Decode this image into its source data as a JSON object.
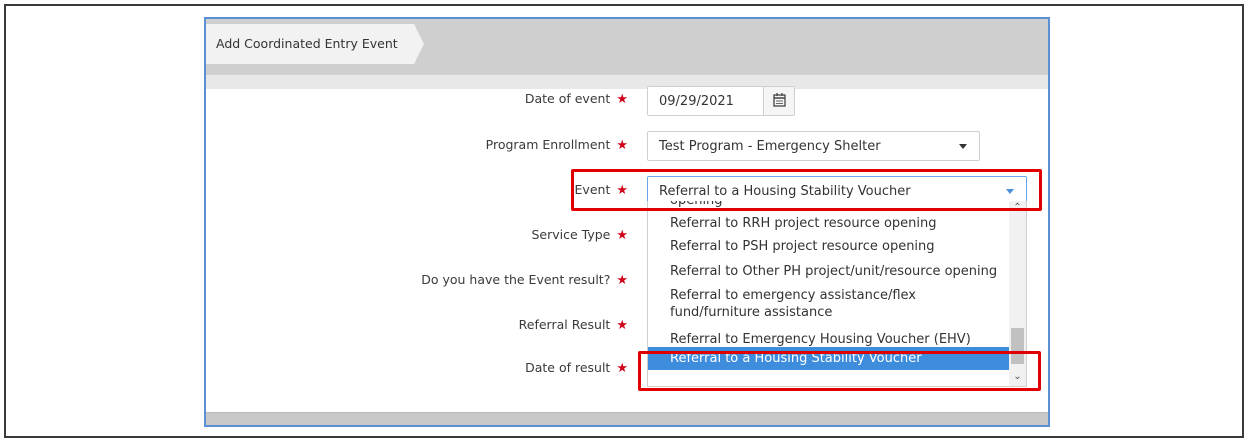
{
  "tab": {
    "title": "Add Coordinated Entry Event"
  },
  "form": {
    "date_of_event": {
      "label": "Date of event",
      "value": "09/29/2021",
      "required": "★"
    },
    "program_enrollment": {
      "label": "Program Enrollment",
      "value": "Test Program - Emergency Shelter",
      "required": "★"
    },
    "event": {
      "label": "Event",
      "value": "Referral to a Housing Stability Voucher",
      "required": "★"
    },
    "service_type": {
      "label": "Service Type",
      "required": "★"
    },
    "event_result": {
      "label": "Do you have the Event result?",
      "required": "★"
    },
    "referral_result": {
      "label": "Referral Result",
      "required": "★"
    },
    "date_of_result": {
      "label": "Date of result",
      "required": "★"
    }
  },
  "event_options": [
    "opening",
    "Referral to RRH project resource opening",
    "Referral to PSH project resource opening",
    "Referral to Other PH project/unit/resource opening",
    "Referral to emergency assistance/flex",
    "fund/furniture assistance",
    "Referral to Emergency Housing Voucher (EHV)",
    "Referral to a Housing Stability Voucher"
  ],
  "icons": {
    "calendar": "calendar-icon",
    "caret": "chevron-down-icon"
  },
  "colors": {
    "required": "#d0021b",
    "highlight": "#e00000",
    "selected": "#3e8ddd",
    "panel_border": "#5b8fd4"
  }
}
